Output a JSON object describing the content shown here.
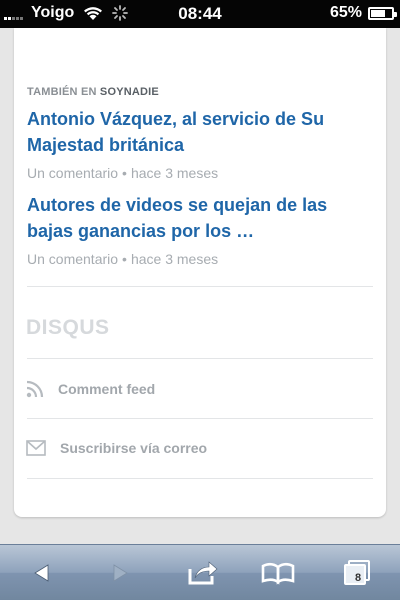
{
  "status_bar": {
    "carrier": "Yoigo",
    "time": "08:44",
    "battery": "65%"
  },
  "related": {
    "label_prefix": "TAMBIÉN EN",
    "label_site": "SOYNADIE",
    "items": [
      {
        "title": "Antonio Vázquez, al servicio de Su Majestad británica",
        "comments": "Un comentario",
        "separator": "•",
        "age": "hace 3 meses"
      },
      {
        "title": "Autores de videos se quejan de las bajas ganancias por los …",
        "comments": "Un comentario",
        "separator": "•",
        "age": "hace 3 meses"
      }
    ]
  },
  "footer": {
    "logo": "DISQUS",
    "comment_feed": "Comment feed",
    "subscribe_email": "Suscribirse vía correo"
  },
  "toolbar": {
    "tabs_count": "8"
  },
  "colors": {
    "link_blue": "#1f66a8",
    "meta_gray": "#a7acb1",
    "toolbar_blue": "#8ea2bb"
  },
  "icons": [
    "signal-bars-icon",
    "wifi-icon",
    "activity-spinner-icon",
    "battery-icon",
    "rss-icon",
    "mail-icon",
    "back-arrow-icon",
    "forward-arrow-icon",
    "share-icon",
    "bookmarks-icon",
    "tabs-icon"
  ]
}
